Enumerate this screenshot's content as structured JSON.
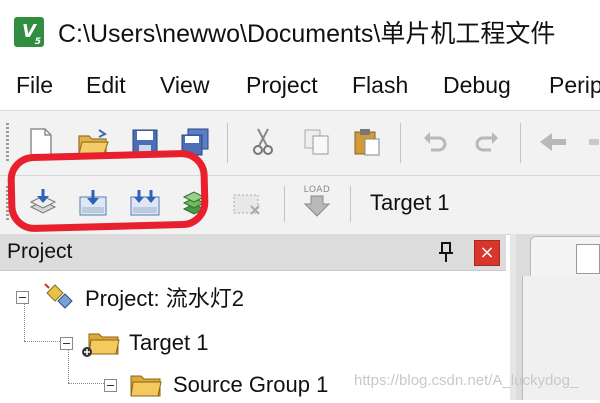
{
  "window": {
    "title": "C:\\Users\\newwo\\Documents\\单片机工程文件"
  },
  "menu": [
    "File",
    "Edit",
    "View",
    "Project",
    "Flash",
    "Debug",
    "Perip"
  ],
  "toolbar1": {
    "icons": [
      "new-file-icon",
      "open-folder-icon",
      "save-icon",
      "save-all-icon",
      "cut-icon",
      "copy-icon",
      "paste-icon",
      "undo-icon",
      "redo-icon",
      "navigate-back-icon"
    ]
  },
  "toolbar2": {
    "icons": [
      "translate-icon",
      "build-icon",
      "rebuild-icon",
      "batch-build-icon",
      "stop-build-icon",
      "download-icon"
    ],
    "load_label": "LOAD",
    "target": "Target 1"
  },
  "project_panel": {
    "title": "Project",
    "close_glyph": "×",
    "tree": [
      {
        "label": "Project: 流水灯2"
      },
      {
        "label": "Target 1"
      },
      {
        "label": "Source Group 1"
      }
    ]
  },
  "watermark": "https://blog.csdn.net/A_luckydog_",
  "colors": {
    "annotation": "#e8202e",
    "close_button": "#d8362a",
    "toolbar_bg": "#f2f2f2",
    "panel_header_bg": "#dcdcdc"
  }
}
